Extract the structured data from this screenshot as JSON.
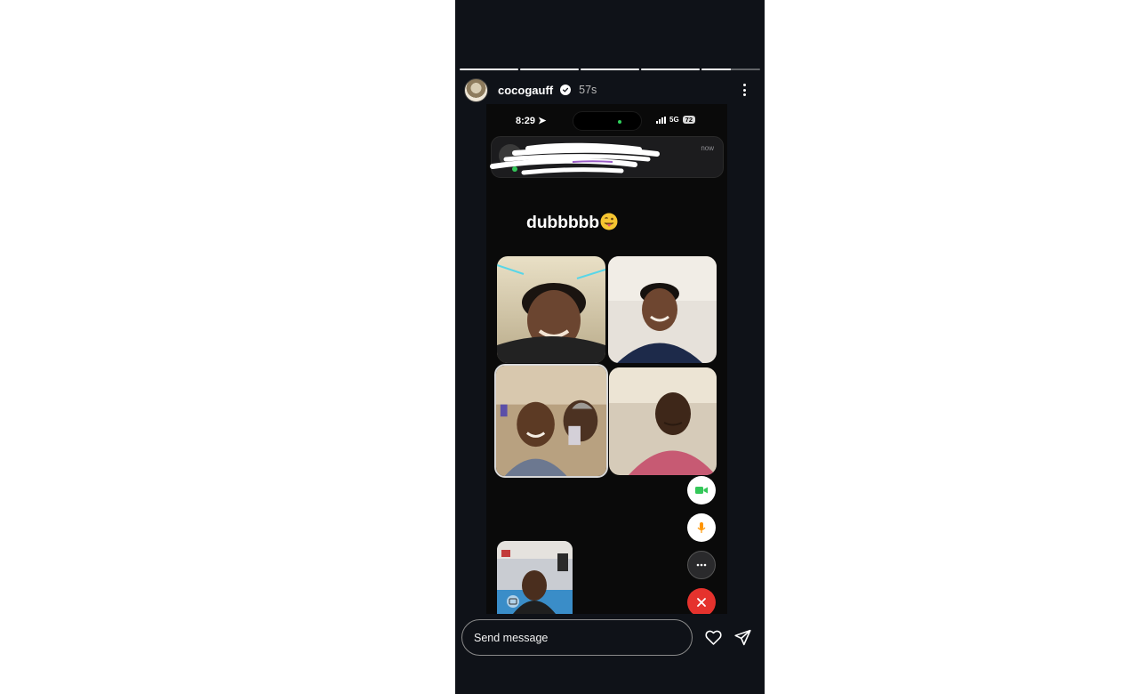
{
  "story": {
    "progress_segments": [
      1,
      1,
      1,
      1,
      0.5
    ],
    "username": "cocogauff",
    "verified": true,
    "timestamp": "57s",
    "more_icon": "more-vertical-icon"
  },
  "screenshot": {
    "status_time": "8:29",
    "network": "5G",
    "battery": "72",
    "notification_time": "now",
    "caption": "dubbbbb",
    "caption_emoji": "tongue-out-emoji"
  },
  "call_controls": [
    {
      "name": "video-icon",
      "color": "#34c759"
    },
    {
      "name": "microphone-icon",
      "color": "#ff9500"
    },
    {
      "name": "more-horizontal-icon",
      "color": "#ffffff"
    },
    {
      "name": "end-call-icon",
      "color": "#e5322d"
    }
  ],
  "footer": {
    "message_placeholder": "Send message",
    "like_icon": "heart-icon",
    "share_icon": "send-icon"
  }
}
